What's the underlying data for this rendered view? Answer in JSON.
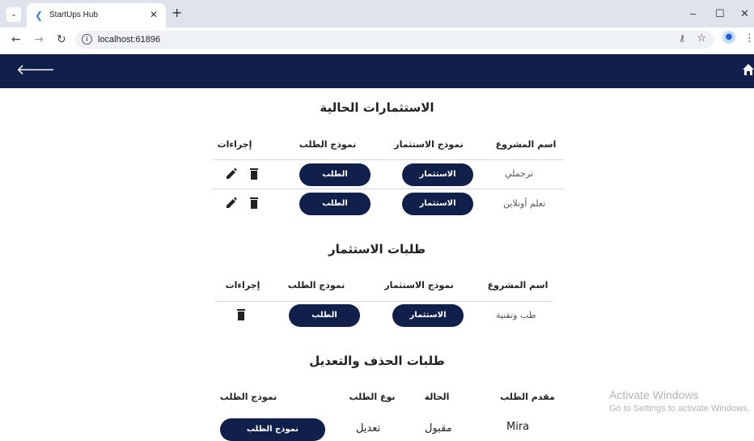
{
  "browser": {
    "tab_title": "StartUps Hub",
    "url": "localhost:61896",
    "window_controls": {
      "minimize": "–",
      "maximize": "☐",
      "close": "✕"
    }
  },
  "icons": {
    "back": "arrow-left-icon",
    "home": "home-icon",
    "edit": "pencil-icon",
    "delete": "trash-icon"
  },
  "colors": {
    "app_bar": "#10204a",
    "pill": "#10204a"
  },
  "current_investments": {
    "title": "الاستثمارات الحالية",
    "headers": [
      "اسم المشروع",
      "نموذج الاستثمار",
      "نموذج الطلب",
      "إجراءات"
    ],
    "rows": [
      {
        "project": "ترجملي",
        "investment_btn": "الاستثمار",
        "request_btn": "الطلب"
      },
      {
        "project": "تعلم أونلاين",
        "investment_btn": "الاستثمار",
        "request_btn": "الطلب"
      }
    ]
  },
  "investment_requests": {
    "title": "طلبات الاستثمار",
    "headers": [
      "اسم المشروع",
      "نموذج الاستثمار",
      "نموذج الطلب",
      "إجراءات"
    ],
    "rows": [
      {
        "project": "طب وتقنية",
        "investment_btn": "الاستثمار",
        "request_btn": "الطلب"
      }
    ]
  },
  "delete_edit_requests": {
    "title": "طلبات الحذف والتعديل",
    "headers": [
      "مقدم الطلب",
      "الحالة",
      "نوع الطلب",
      "نموذج الطلب"
    ],
    "rows": [
      {
        "applicant": "Mira",
        "status": "مقبول",
        "type": "تعديل",
        "form_btn": "نموذج الطلب"
      }
    ]
  },
  "watermark": {
    "line1": "Activate Windows",
    "line2": "Go to Settings to activate Windows."
  }
}
